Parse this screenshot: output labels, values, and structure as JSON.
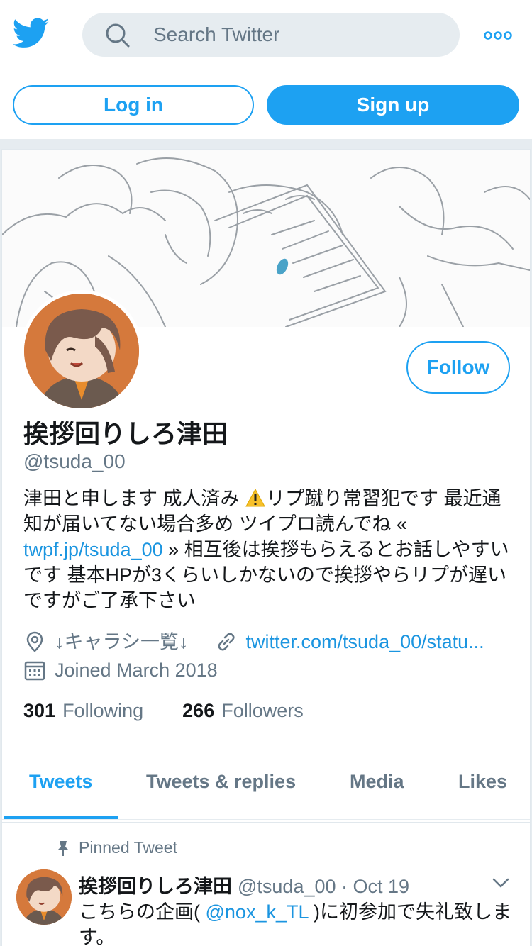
{
  "header": {
    "search_placeholder": "Search Twitter",
    "login_label": "Log in",
    "signup_label": "Sign up"
  },
  "profile": {
    "name": "挨拶回りしろ津田",
    "handle": "@tsuda_00",
    "follow_label": "Follow",
    "bio_part1": "津田と申します 成人済み ",
    "bio_part2": "リプ蹴り常習犯です 最近通知が届いてない場合多め ツイプロ読んでね « ",
    "bio_link": "twpf.jp/tsuda_00",
    "bio_part3": " » 相互後は挨拶もらえるとお話しやすいです 基本HPが3くらいしかないので挨拶やらリプが遅いですがご了承下さい",
    "location": "↓キャラシ一覧↓",
    "website": "twitter.com/tsuda_00/statu...",
    "joined": "Joined March 2018",
    "following_count": "301",
    "following_label": "Following",
    "followers_count": "266",
    "followers_label": "Followers"
  },
  "tabs": [
    {
      "label": "Tweets",
      "active": true
    },
    {
      "label": "Tweets & replies",
      "active": false
    },
    {
      "label": "Media",
      "active": false
    },
    {
      "label": "Likes",
      "active": false
    }
  ],
  "pinned_tweet": {
    "pinned_label": "Pinned Tweet",
    "author_name": "挨拶回りしろ津田",
    "author_handle": "@tsuda_00",
    "separator": " · ",
    "date": "Oct 19",
    "text_before": "こちらの企画( ",
    "mention": "@nox_k_TL",
    "text_after": " )に初参加で失礼致します。"
  },
  "colors": {
    "accent": "#1da1f2",
    "link": "#1b95e0",
    "secondary_text": "#657786",
    "background": "#e6ecf0"
  },
  "icons": [
    "twitter-logo-icon",
    "search-icon",
    "more-icon",
    "location-icon",
    "link-icon",
    "calendar-icon",
    "pin-icon",
    "chevron-down-icon",
    "warning-icon"
  ]
}
